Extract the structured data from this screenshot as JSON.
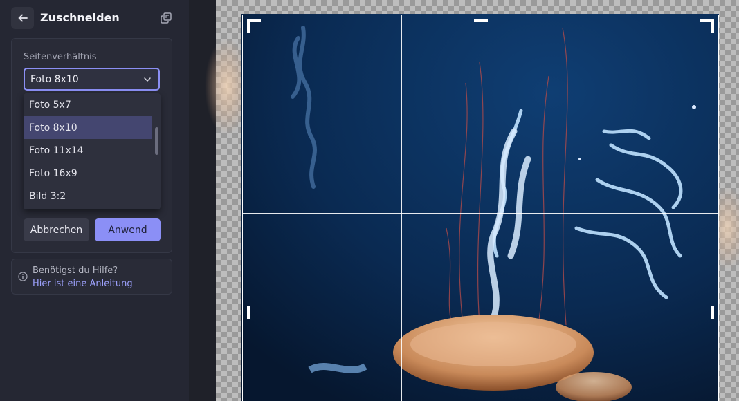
{
  "header": {
    "title": "Zuschneiden",
    "back_icon": "arrow-left-icon",
    "copy_icon": "copy-icon"
  },
  "aspect": {
    "label": "Seitenverhältnis",
    "selected": "Foto 8x10",
    "options": [
      {
        "label": "Foto 5x7",
        "selected": false
      },
      {
        "label": "Foto 8x10",
        "selected": true
      },
      {
        "label": "Foto 11x14",
        "selected": false
      },
      {
        "label": "Foto 16x9",
        "selected": false
      },
      {
        "label": "Bild 3:2",
        "selected": false
      }
    ]
  },
  "actions": {
    "cancel": "Abbrechen",
    "apply": "Anwend"
  },
  "help": {
    "question": "Benötigst du Hilfe?",
    "link": "Hier ist eine Anleitung"
  },
  "colors": {
    "accent": "#8b8ff6",
    "panel": "#292b37",
    "sidebar": "#252733",
    "canvas_bg": "#1f2129",
    "water": "#0b2a52"
  }
}
